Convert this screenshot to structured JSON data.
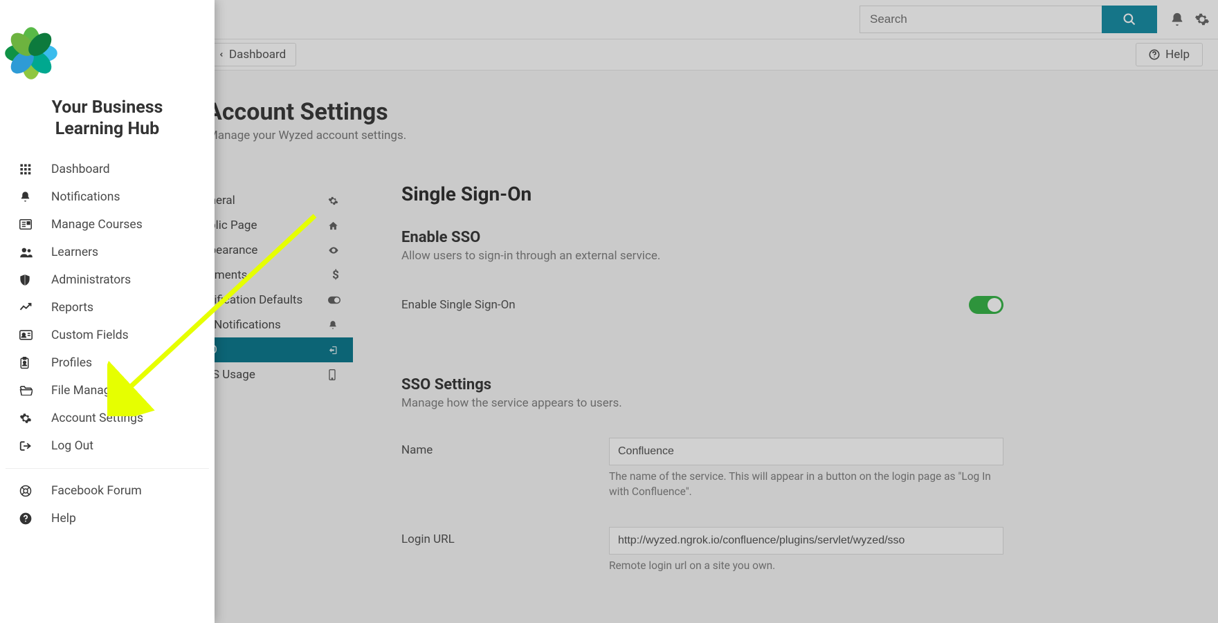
{
  "brand": {
    "title_line1": "Your Business",
    "title_line2": "Learning Hub"
  },
  "sidebar": {
    "items": [
      {
        "label": "Dashboard",
        "icon": "grid"
      },
      {
        "label": "Notifications",
        "icon": "bell"
      },
      {
        "label": "Manage Courses",
        "icon": "news"
      },
      {
        "label": "Learners",
        "icon": "users"
      },
      {
        "label": "Administrators",
        "icon": "shield"
      },
      {
        "label": "Reports",
        "icon": "chart"
      },
      {
        "label": "Custom Fields",
        "icon": "idcard"
      },
      {
        "label": "Profiles",
        "icon": "badge"
      },
      {
        "label": "File Manager",
        "icon": "folder"
      },
      {
        "label": "Account Settings",
        "icon": "gear"
      },
      {
        "label": "Log Out",
        "icon": "signout"
      }
    ],
    "footer_items": [
      {
        "label": "Facebook Forum",
        "icon": "lifebuoy"
      },
      {
        "label": "Help",
        "icon": "help"
      }
    ]
  },
  "header": {
    "search_placeholder": "Search",
    "breadcrumb_label": "Dashboard",
    "help_label": "Help"
  },
  "page": {
    "title": "Account Settings",
    "subtitle": "Manage your Wyzed account settings."
  },
  "settings_tabs": [
    {
      "label": "General",
      "icon": "gear"
    },
    {
      "label": "Public Page",
      "icon": "home"
    },
    {
      "label": "Appearance",
      "icon": "eye"
    },
    {
      "label": "Payments",
      "icon": "dollar"
    },
    {
      "label": "Notification Defaults",
      "icon": "toggle"
    },
    {
      "label": "My Notifications",
      "icon": "bell"
    },
    {
      "label": "SSO",
      "icon": "signin",
      "active": true
    },
    {
      "label": "SMS Usage",
      "icon": "phone"
    }
  ],
  "sso": {
    "heading": "Single Sign-On",
    "enable_heading": "Enable SSO",
    "enable_sub": "Allow users to sign-in through an external service.",
    "enable_label": "Enable Single Sign-On",
    "enabled": true,
    "settings_heading": "SSO Settings",
    "settings_sub": "Manage how the service appears to users.",
    "name_label": "Name",
    "name_value": "Confluence",
    "name_hint": "The name of the service. This will appear in a button on the login page as \"Log In with Confluence\".",
    "login_url_label": "Login URL",
    "login_url_value": "http://wyzed.ngrok.io/confluence/plugins/servlet/wyzed/sso",
    "login_url_hint": "Remote login url on a site you own."
  }
}
